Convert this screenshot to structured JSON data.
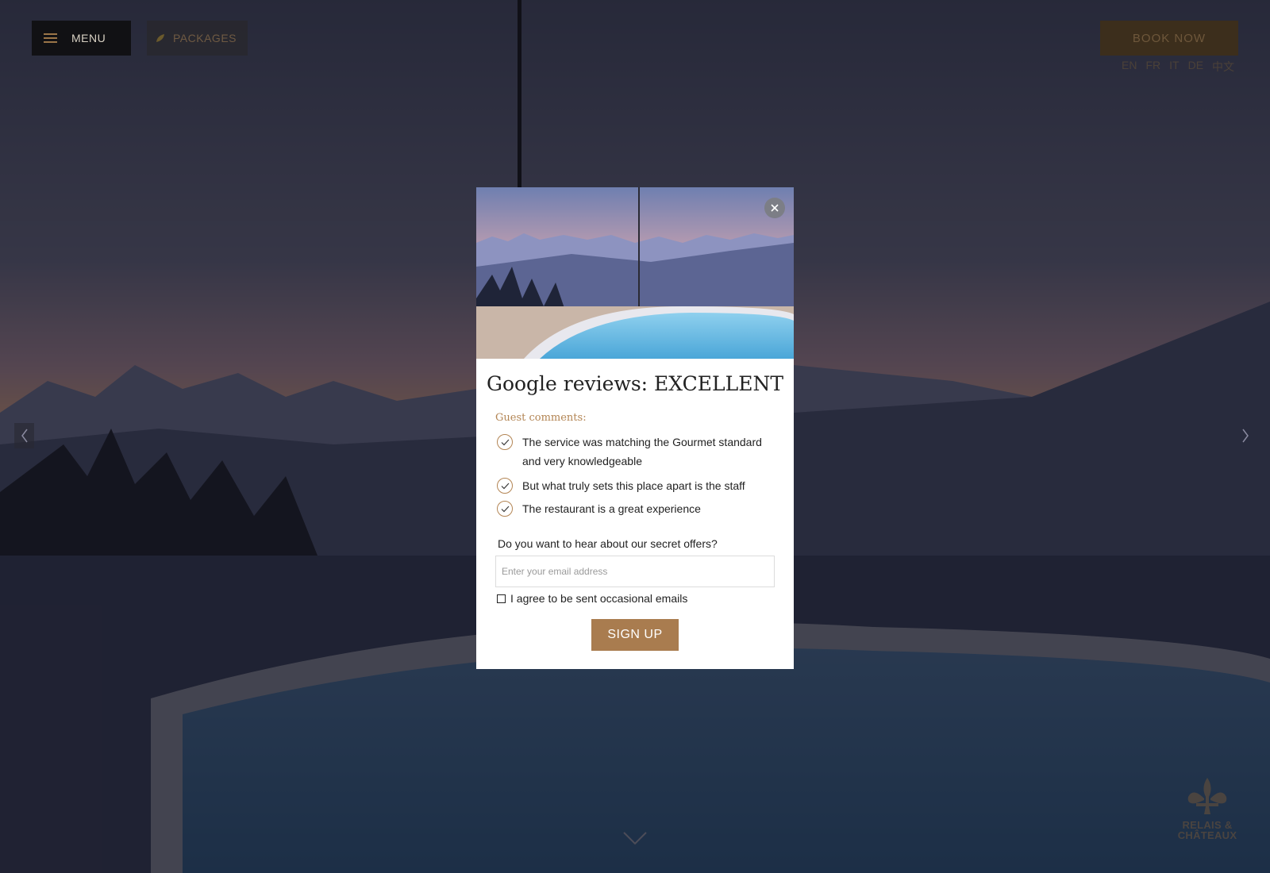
{
  "header": {
    "menu_label": "MENU",
    "packages_label": "PACKAGES",
    "book_now_label": "BOOK NOW",
    "languages": [
      "EN",
      "FR",
      "IT",
      "DE",
      "中文"
    ]
  },
  "logo": {
    "brand_text": "RELAIS &\nCHÂTEAUX"
  },
  "modal": {
    "title": "Google reviews: EXCELLENT",
    "guest_comments_label": "Guest comments:",
    "comments": [
      "The service was matching the Gourmet standard and very knowledgeable",
      "But what truly sets this place apart is the staff",
      "The restaurant is a great experience"
    ],
    "offer_question": "Do you want to hear about our secret offers?",
    "email_placeholder": "Enter your email address",
    "email_value": "",
    "agree_label": "I agree to be sent occasional emails",
    "agree_checked": false,
    "signup_label": "SIGN UP"
  },
  "colors": {
    "accent": "#a97c4f",
    "book_button": "#3c2e1c",
    "menu_button": "#111114",
    "modal_background": "#ffffff"
  },
  "icons": {
    "menu": "hamburger-icon",
    "packages": "leaf-icon",
    "close": "close-icon",
    "comment": "check-circle-icon",
    "prev": "chevron-left-icon",
    "next": "chevron-right-icon",
    "scroll": "chevron-down-icon",
    "logo": "fleur-de-lis-icon"
  }
}
